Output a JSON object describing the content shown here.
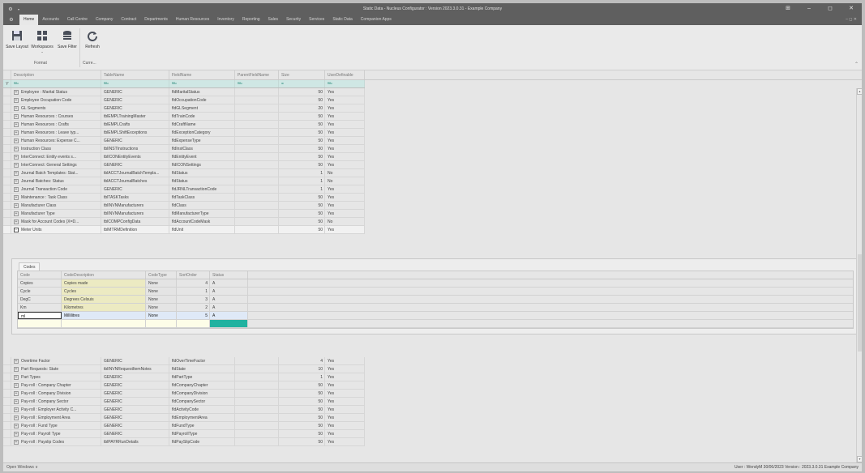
{
  "window": {
    "title": "Static Data - Nucleus Configurator : Version 2023.3.0.31 - Example Company",
    "controls": [
      "⊞",
      "–",
      "◻",
      "✕"
    ]
  },
  "menu": {
    "tabs": [
      "Home",
      "Accounts",
      "Call Centre",
      "Company",
      "Contract",
      "Departments",
      "Human Resources",
      "Inventory",
      "Reporting",
      "Sales",
      "Security",
      "Services",
      "Static Data",
      "Companion Apps"
    ],
    "right": "– ◻ ✕"
  },
  "ribbon": {
    "buttons": {
      "save_layout": "Save Layout",
      "workspaces": "Workspaces",
      "save_filter": "Save Filter",
      "refresh": "Refresh"
    },
    "groups": {
      "format": "Format",
      "current": "Curre..."
    }
  },
  "grid": {
    "columns": [
      "Description",
      "TableName",
      "FieldName",
      "ParentFieldName",
      "Size",
      "UserDefinable"
    ],
    "filter_tokens": [
      "ᴿᴮᶜ",
      "ᴿᴮᶜ",
      "ᴿᴮᶜ",
      "ᴿᴮᶜ",
      "=",
      "ᴿᴮᶜ"
    ],
    "rows_top": [
      [
        "Employee : Marital Status",
        "GENERIC",
        "fldMaritalStatus",
        "",
        "50",
        "Yes"
      ],
      [
        "Employee Occupation Code",
        "GENERIC",
        "fldOccupationCode",
        "",
        "50",
        "Yes"
      ],
      [
        "GL Segments",
        "GENERIC",
        "fldGLSegment",
        "",
        "20",
        "Yes"
      ],
      [
        "Human Resources : Courses",
        "tblEMPLTrainingMaster",
        "fldTrainCode",
        "",
        "50",
        "Yes"
      ],
      [
        "Human Resources : Crafts",
        "tblEMPLCrafts",
        "fldCraftName",
        "",
        "50",
        "Yes"
      ],
      [
        "Human Resources : Leave typ...",
        "tblEMPLShiftExceptions",
        "fldExceptionCategory",
        "",
        "50",
        "Yes"
      ],
      [
        "Human Resources: Expense C...",
        "GENERIC",
        "fldExpenseType",
        "",
        "50",
        "Yes"
      ],
      [
        "Instruction Class",
        "tblINSTInstructions",
        "fldInstClass",
        "",
        "50",
        "Yes"
      ],
      [
        "InterConnect: Entity events s...",
        "tblICONEntityEvents",
        "fldEntityEvent",
        "",
        "50",
        "Yes"
      ],
      [
        "InterConnect: General Settings",
        "GENERIC",
        "fldICONSettings",
        "",
        "50",
        "Yes"
      ],
      [
        "Journal Batch Templates: Stat...",
        "tblACCTJournalBatchTempla...",
        "fldStatus",
        "",
        "1",
        "No"
      ],
      [
        "Journal Batches: Status",
        "tblACCTJournalBatches",
        "fldStatus",
        "",
        "1",
        "No"
      ],
      [
        "Journal Transaction Code",
        "GENERIC",
        "fldJRNLTransactionCode",
        "",
        "1",
        "Yes"
      ],
      [
        "Maintenance : Task Class",
        "tblTASKTasks",
        "fldTaskClass",
        "",
        "50",
        "Yes"
      ],
      [
        "Manufacturer Class",
        "tblINVNManufacturers",
        "fldClass",
        "",
        "50",
        "Yes"
      ],
      [
        "Manufacturer Type",
        "tblINVNManufacturers",
        "fldManufacturerType",
        "",
        "50",
        "Yes"
      ],
      [
        "Mask for Account Codes (X=D...",
        "tblCOMPConfigData",
        "fldAccountCodeMask",
        "",
        "50",
        "No"
      ],
      [
        "Meter Units",
        "tblMTRMDefinition",
        "fldUnit",
        "",
        "50",
        "Yes"
      ]
    ],
    "detail": {
      "tab": "Codes",
      "columns": [
        "Code",
        "CodeDescription",
        "CodeType",
        "SortOrder",
        "Status"
      ],
      "rows": [
        [
          "Copies",
          "Copies made",
          "None",
          "4",
          "A"
        ],
        [
          "Cycle",
          "Cycles",
          "None",
          "1",
          "A"
        ],
        [
          "DegC",
          "Degrees Celsuis",
          "None",
          "3",
          "A"
        ],
        [
          "Km",
          "Kilometres",
          "None",
          "2",
          "A"
        ],
        [
          "ml",
          "Millilitres",
          "None",
          "5",
          "A"
        ]
      ]
    },
    "rows_bottom": [
      [
        "Overtime Factor",
        "GENERIC",
        "fldOverTimeFactor",
        "",
        "4",
        "Yes"
      ],
      [
        "Part Requests: State",
        "tblINVNRequestItemNotes",
        "fldState",
        "",
        "10",
        "Yes"
      ],
      [
        "Part Types",
        "GENERIC",
        "fldPartType",
        "",
        "1",
        "Yes"
      ],
      [
        "Pay-roll : Company Chapter",
        "GENERIC",
        "fldCompanyChapter",
        "",
        "50",
        "Yes"
      ],
      [
        "Pay-roll : Company Division",
        "GENERIC",
        "fldCompanyDivision",
        "",
        "50",
        "Yes"
      ],
      [
        "Pay-roll : Company Sector",
        "GENERIC",
        "fldCompanySector",
        "",
        "50",
        "Yes"
      ],
      [
        "Pay-roll : Employer Activity C...",
        "GENERIC",
        "fldActivityCode",
        "",
        "50",
        "Yes"
      ],
      [
        "Pay-roll : Employment Area",
        "GENERIC",
        "fldEmploymentArea",
        "",
        "50",
        "Yes"
      ],
      [
        "Pay-roll : Fund Type",
        "GENERIC",
        "fldFundType",
        "",
        "50",
        "Yes"
      ],
      [
        "Pay-roll : Payroll Type",
        "GENERIC",
        "fldPayrollType",
        "",
        "50",
        "Yes"
      ],
      [
        "Pay-roll : Payslip Codes",
        "tblPAYRRunDetails",
        "fldPaySlipCode",
        "",
        "50",
        "Yes"
      ]
    ]
  },
  "statusbar": {
    "open_windows": "Open Windows ∨",
    "info": "User : WendyM  30/06/2023  Version : 2023.3.0.31  Example Company"
  },
  "colors": {
    "title_bg": "#5f5f5f",
    "filter_bg": "#cfe7e4",
    "status_cell": "#20b2a0",
    "code_desc_bg": "#eceac2"
  }
}
